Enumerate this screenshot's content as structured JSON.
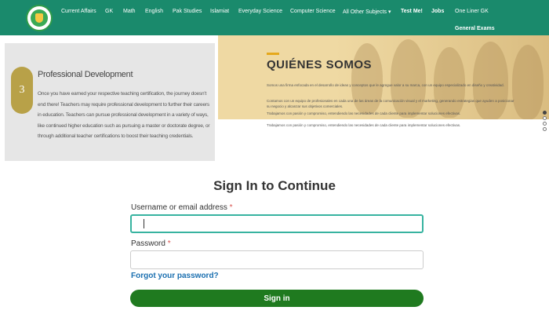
{
  "nav": {
    "items": [
      "Current Affairs",
      "GK",
      "Math",
      "English",
      "Pak Studies",
      "Islamiat",
      "Everyday Science",
      "Computer Science",
      "All Other Subjects",
      "Test Me!",
      "Jobs",
      "One Liner GK"
    ],
    "second_row": "General Exams",
    "dropdown_marker": "▾",
    "colors": {
      "navbar": "#1a8a6c"
    }
  },
  "pd_card": {
    "number": "3",
    "title": "Professional Development",
    "text": "Once you have earned your respective teaching certification, the journey doesn't end there! Teachers may require professional development to further their careers in education. Teachers can pursue professional development in a variety of ways, like continued higher education such as pursuing a master or doctorate degree, or through additional teacher certifications to boost their teaching credentials."
  },
  "banner": {
    "title": "QUIÉNES SOMOS",
    "paragraphs": [
      "Somos una firma enfocada en el desarrollo de ideas y conceptos que le agregue valor a su marca, con un equipo especializado en diseño y creatividad.",
      "Contamos con un equipo de profesionales en cada una de las áreas de la comunicación visual y el marketing, generando estrategias que ayuden a posicionar su negocio y alcanzar sus objetivos comerciales.",
      "Trabajamos con pasión y compromiso, entendiendo las necesidades de cada cliente para implementar soluciones efectivas."
    ],
    "below_text": "Trabajamos con pasión y compromiso, entendiendo las necesidades de cada cliente para implementar soluciones efectivas."
  },
  "form": {
    "title": "Sign In to Continue",
    "username_label": "Username or email address",
    "password_label": "Password",
    "required_marker": "*",
    "username_value": "",
    "password_value": "",
    "forgot_link": "Forgot your password?",
    "submit_label": "Sign in",
    "colors": {
      "button": "#1f7a1f",
      "focus_border": "#37b3a0",
      "link": "#1a6fb0"
    }
  }
}
